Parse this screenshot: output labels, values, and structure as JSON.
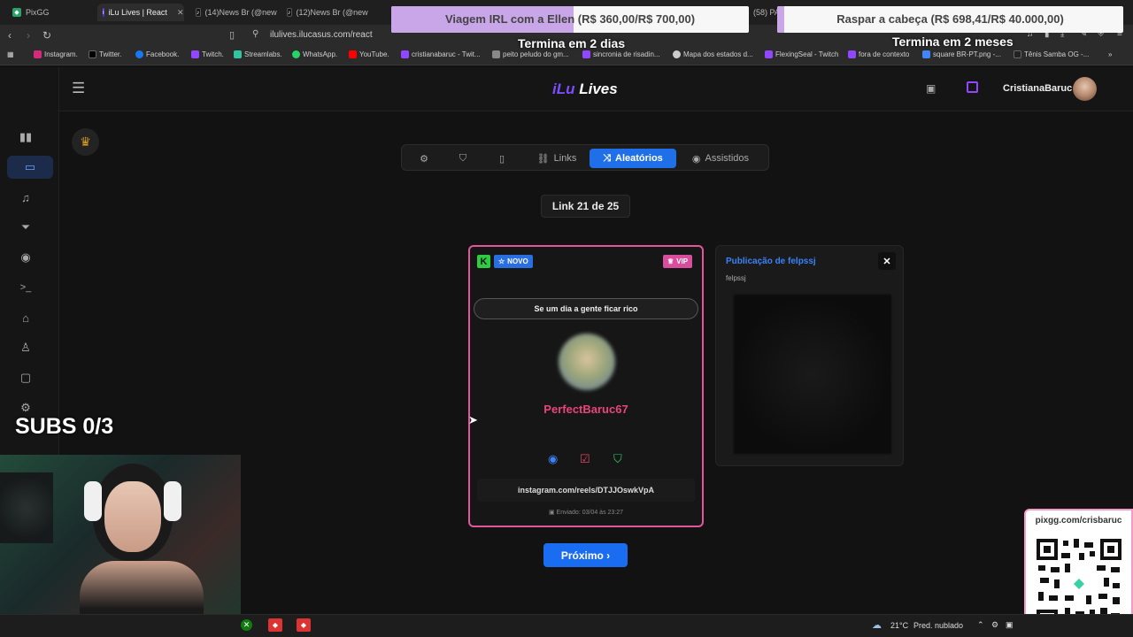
{
  "browser": {
    "tabs": [
      {
        "label": "PixGG",
        "active": false
      },
      {
        "label": "iLu Lives | React",
        "active": true
      },
      {
        "label": "(14)News Br (@new",
        "active": false
      },
      {
        "label": "(12)News Br (@new",
        "active": false
      },
      {
        "label": "(58) PA",
        "active": false
      }
    ],
    "url": "ilulives.ilucasus.com/react",
    "bookmarks": [
      "Instagram.",
      "Twitter.",
      "Facebook.",
      "Twitch.",
      "Streamlabs.",
      "WhatsApp.",
      "YouTube.",
      "cristianabaruc - Twit...",
      "peito peludo do gm...",
      "sincronia de risadin...",
      "Mapa dos estados d...",
      "FlexingSeal - Twitch",
      "fora de contexto",
      "square BR-PT.png -...",
      "Tênis Samba OG -..."
    ]
  },
  "overlays": {
    "goal1": {
      "label": "Viagem IRL com a Ellen",
      "amount": "(R$ 360,00/R$ 700,00)",
      "progress": 0.51,
      "sub": "Termina em 2 dias"
    },
    "goal2": {
      "label": "Raspar a cabeça",
      "amount": "(R$ 698,41/R$ 40.000,00)",
      "progress": 0.02,
      "sub": "Termina em 2 meses"
    },
    "subs": "SUBS 0/3",
    "qr_label": "pixgg.com/crisbaruc"
  },
  "header": {
    "logo_small": "iLu",
    "logo_brand": "iLu",
    "logo_suffix": "Lives",
    "username": "CristianaBaruc"
  },
  "sidebar": {
    "icons": [
      "chart-icon",
      "monitor-icon",
      "music-icon",
      "filter-icon",
      "camera-icon",
      "terminal-icon",
      "gift-icon",
      "badge-icon",
      "chat-icon",
      "settings-icon"
    ],
    "active_index": 1
  },
  "toolbar": {
    "links": "Links",
    "random": "Aleatórios",
    "watched": "Assistidos"
  },
  "counter": "Link 21 de 25",
  "card": {
    "new_badge": "NOVO",
    "vip_badge": "VIP",
    "title": "Se um dia a gente ficar rico",
    "username": "PerfectBaruc67",
    "link": "instagram.com/reels/DTJJOswkVpA",
    "sent": "Enviado: 03/04 às 23:27"
  },
  "side_card": {
    "title": "Publicação de felpssj",
    "subtitle": "felpssj"
  },
  "next_button": "Próximo ›",
  "taskbar": {
    "weather": "21°C",
    "weather_desc": "Pred. nublado"
  },
  "colors": {
    "accent": "#1f6fe8",
    "card_border": "#e2569c",
    "username": "#e8457a",
    "vip": "#d94e9c"
  }
}
